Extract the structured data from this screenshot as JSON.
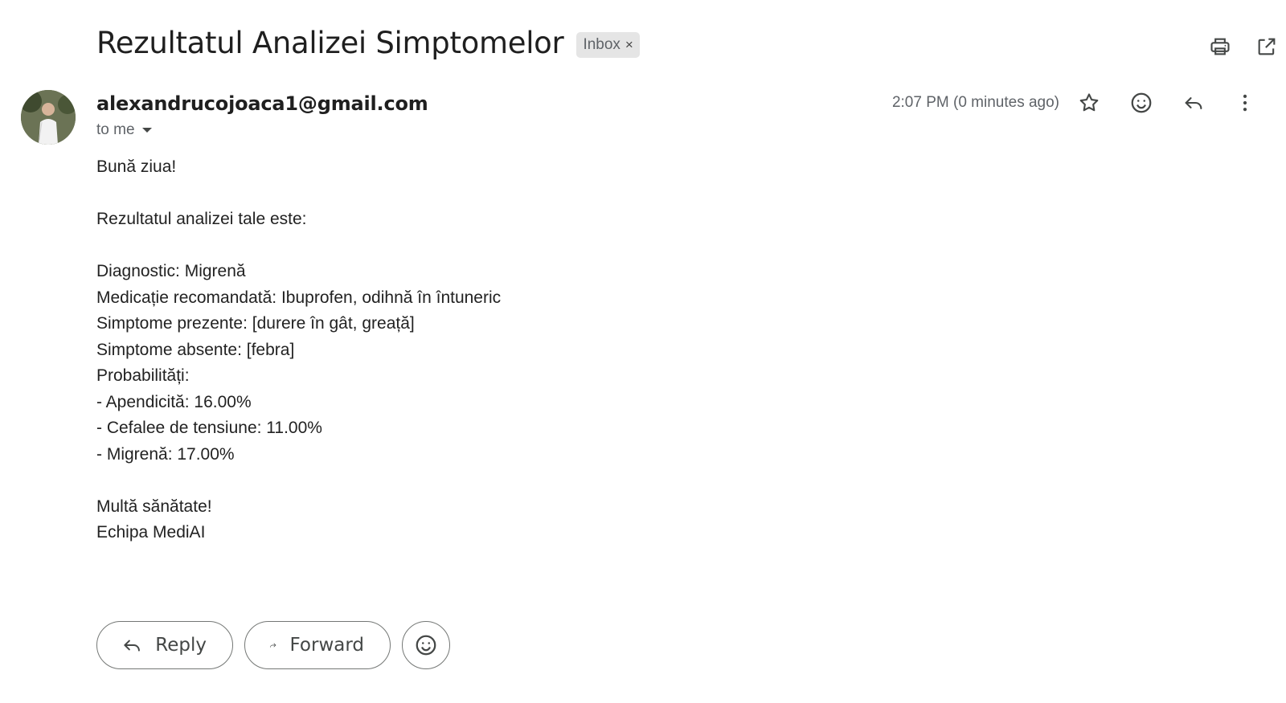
{
  "email": {
    "subject": "Rezultatul Analizei Simptomelor",
    "label": "Inbox",
    "label_close": "×",
    "sender": "alexandrucojoaca1@gmail.com",
    "recipient": "to me",
    "timestamp": "2:07 PM (0 minutes ago)"
  },
  "body": {
    "greeting": "Bună ziua!",
    "intro": "Rezultatul analizei tale este:",
    "diagnostic": "Diagnostic: Migrenă",
    "medication": "Medicație recomandată: Ibuprofen, odihnă în întuneric",
    "present": "Simptome prezente: [durere în gât, greață]",
    "absent": "Simptome absente: [febra]",
    "prob_heading": "Probabilități:",
    "probabilities": [
      "- Apendicită: 16.00%",
      "- Cefalee de tensiune: 11.00%",
      "- Migrenă: 17.00%"
    ],
    "closing": "Multă sănătate!",
    "signature": "Echipa MediAI"
  },
  "actions": {
    "reply_label": "Reply",
    "forward_label": "Forward"
  },
  "icons": {
    "print": "print-icon",
    "open_new_window": "open-in-new-icon",
    "star": "star-icon",
    "emoji": "emoji-icon",
    "reply": "reply-icon",
    "more": "more-vert-icon",
    "dropdown": "arrow-drop-down-icon",
    "forward": "forward-icon"
  }
}
